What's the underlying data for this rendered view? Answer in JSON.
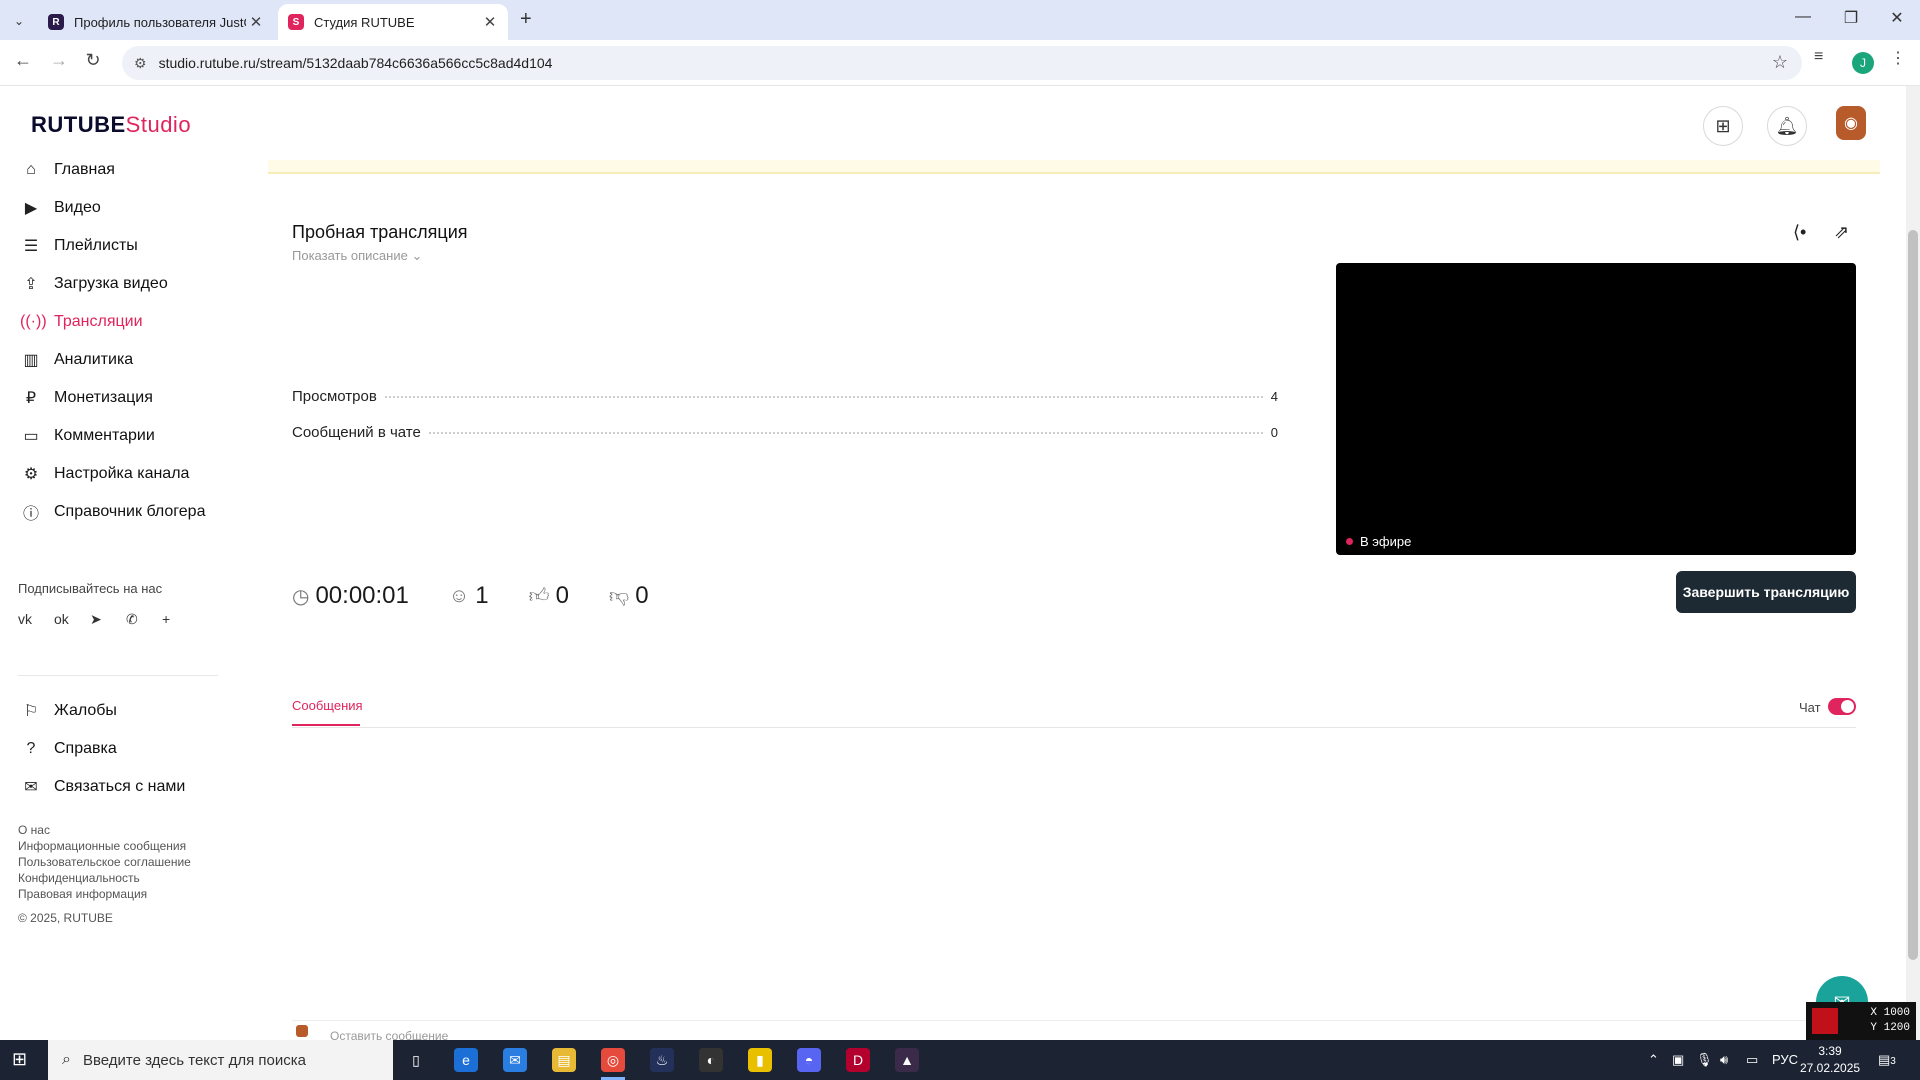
{
  "browser": {
    "tabs": [
      {
        "title": "Профиль пользователя JustGa",
        "active": false
      },
      {
        "title": "Студия RUTUBE",
        "active": true
      }
    ],
    "url": "studio.rutube.ru/stream/5132daab784c6636a566cc5c8ad4d104",
    "profile_initial": "J"
  },
  "header": {
    "logo_main": "RUTUBE",
    "logo_studio": "Studio",
    "icons": [
      "add-video-icon",
      "bell-icon"
    ]
  },
  "sidebar": {
    "items": [
      {
        "label": "Главная",
        "icon": "home-icon"
      },
      {
        "label": "Видео",
        "icon": "video-icon"
      },
      {
        "label": "Плейлисты",
        "icon": "playlist-icon"
      },
      {
        "label": "Загрузка видео",
        "icon": "upload-icon"
      },
      {
        "label": "Трансляции",
        "icon": "broadcast-icon",
        "active": true
      },
      {
        "label": "Аналитика",
        "icon": "analytics-icon"
      },
      {
        "label": "Монетизация",
        "icon": "monetization-icon"
      },
      {
        "label": "Комментарии",
        "icon": "comments-icon"
      },
      {
        "label": "Настройка канала",
        "icon": "settings-icon"
      },
      {
        "label": "Справочник блогера",
        "icon": "info-icon"
      }
    ],
    "subscribe_title": "Подписывайтесь на нас",
    "socials": [
      "vk-icon",
      "ok-icon",
      "telegram-icon",
      "viber-icon",
      "plus-icon"
    ],
    "bottom_items": [
      {
        "label": "Жалобы",
        "icon": "flag-icon"
      },
      {
        "label": "Справка",
        "icon": "help-icon"
      },
      {
        "label": "Связаться с нами",
        "icon": "mail-icon"
      }
    ],
    "footer_links": [
      "О нас",
      "Информационные сообщения",
      "Пользовательское соглашение",
      "Конфиденциальность",
      "Правовая информация"
    ],
    "copyright": "© 2025, RUTUBE"
  },
  "stream": {
    "title": "Пробная трансляция",
    "show_description": "Показать описание",
    "stats": [
      {
        "label": "Просмотров",
        "value": "4"
      },
      {
        "label": "Сообщений в чате",
        "value": "0"
      }
    ],
    "live_badge": "В эфире",
    "duration": "00:00:01",
    "viewers": "1",
    "likes": "0",
    "dislikes": "0",
    "end_button": "Завершить трансляцию"
  },
  "messages": {
    "tab_label": "Сообщения",
    "chat_label": "Чат",
    "chat_enabled": true,
    "input_placeholder": "Оставить сообщение"
  },
  "overlay": {
    "x_readout": "X 1000",
    "y_readout": "Y 1200"
  },
  "taskbar": {
    "search_placeholder": "Введите здесь текст для поиска",
    "language": "РУС",
    "time": "3:39",
    "date": "27.02.2025",
    "notification_count": "3"
  },
  "colors": {
    "accent": "#e0245e",
    "dark_button": "#1e2a33",
    "taskbar": "#1c2333"
  }
}
